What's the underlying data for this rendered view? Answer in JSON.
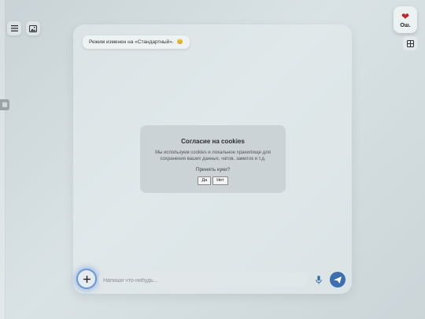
{
  "toolbar": {
    "menu_icon": "hamburger-menu-icon",
    "image_icon": "image-icon",
    "grid_icon": "grid-icon"
  },
  "status": {
    "icon": "broken-heart-icon",
    "label": "Ош."
  },
  "toast": {
    "text": "Режим изменен на «Стандартный».",
    "emoji": "😊"
  },
  "cookie_dialog": {
    "title": "Согласие на cookies",
    "body": "Мы используем cookies и локальное хранилище для сохранения ваших данных, чатов, заметок и т.д.",
    "question": "Принять куки?",
    "accept_label": "Да",
    "decline_label": "Нет"
  },
  "composer": {
    "add_icon": "plus-icon",
    "placeholder": "Напиши что-нибудь...",
    "mic_icon": "microphone-icon",
    "send_icon": "send-icon"
  },
  "colors": {
    "accent": "#3b6fb0",
    "status_heart": "#c0242c"
  }
}
